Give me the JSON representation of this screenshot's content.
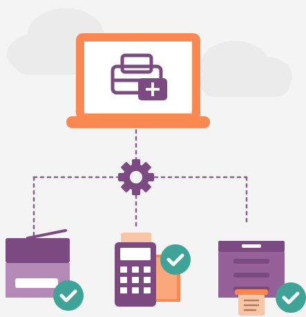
{
  "colors": {
    "background": "#f4f4f4",
    "cloud": "#ebebeb",
    "laptop": "#fa8850",
    "laptop_screen": "#ffffff",
    "purple": "#7b4a80",
    "purple_light": "#956198",
    "purple_lighter": "#b489b5",
    "peach": "#f8c5a5",
    "orange": "#fa8850",
    "check_badge": "#3fa497",
    "connector": "#8a5d8d"
  },
  "icons": {
    "central_app": "printer-plus-icon",
    "hub": "gear-icon",
    "left_device": "multifunction-printer-icon",
    "middle_device": "payment-terminal-icon",
    "right_device": "receipt-printer-icon",
    "status": "check-badge-icon"
  }
}
